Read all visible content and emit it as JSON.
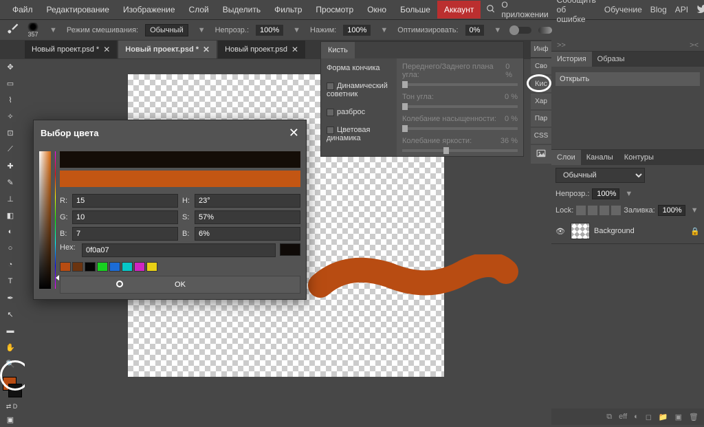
{
  "menubar": {
    "items": [
      "Файл",
      "Редактирование",
      "Изображение",
      "Слой",
      "Выделить",
      "Фильтр",
      "Просмотр",
      "Окно",
      "Больше"
    ],
    "account": "Аккаунт",
    "right": [
      "О приложении",
      "Сообщить об ошибке",
      "Обучение",
      "Blog",
      "API"
    ]
  },
  "optionsbar": {
    "brush_size": "357",
    "blend_mode_label": "Режим смешивания:",
    "blend_mode": "Обычный",
    "opacity_label": "Непрозр.:",
    "opacity": "100%",
    "flow_label": "Нажим:",
    "flow": "100%",
    "smooth_label": "Оптимизировать:",
    "smooth": "0%"
  },
  "tabs": [
    {
      "label": "Новый проект.psd *",
      "active": false
    },
    {
      "label": "Новый проект.psd *",
      "active": true
    },
    {
      "label": "Новый проект.psd",
      "active": false
    }
  ],
  "colorpicker": {
    "title": "Выбор цвета",
    "r_label": "R:",
    "r": "15",
    "g_label": "G:",
    "g": "10",
    "b_label": "B:",
    "b": "7",
    "h_label": "H:",
    "h": "23°",
    "s_label": "S:",
    "s": "57%",
    "v_label": "B:",
    "v": "6%",
    "hex_label": "Hex:",
    "hex": "0f0a07",
    "ok": "OK",
    "swatches": [
      "#b84c12",
      "#6b3410",
      "#050505",
      "#18d020",
      "#1c6cd6",
      "#07c7c7",
      "#d025c2",
      "#e8d015"
    ]
  },
  "brushpanel": {
    "tab": "Кисть",
    "tip_shape": "Форма кончика",
    "dynamic_label": "Динамический советник",
    "scatter_label": "разброс",
    "color_dyn_label": "Цветовая динамика",
    "fg_bg_label": "Переднего/Заднего плана угла:",
    "fg_bg_val": "0 %",
    "hue_label": "Тон угла:",
    "hue_val": "0 %",
    "sat_label": "Колебание насыщенности:",
    "sat_val": "0 %",
    "bri_label": "Колебание яркости:",
    "bri_val": "36 %"
  },
  "side_tabs": [
    "Инф",
    "Сво",
    "Кис",
    "Хар",
    "Пар",
    "CSS"
  ],
  "history_panel": {
    "tabs": [
      "История",
      "Образы"
    ],
    "action": "Открыть"
  },
  "layers_panel": {
    "tabs": [
      "Слои",
      "Каналы",
      "Контуры"
    ],
    "blend_mode": "Обычный",
    "opacity_label": "Непрозр.:",
    "opacity": "100%",
    "lock_label": "Lock:",
    "fill_label": "Заливка:",
    "fill": "100%",
    "layer_name": "Background"
  },
  "bottombar": {
    "eff": "eff"
  },
  "mini_header": {
    "left": ">>",
    "right": "><"
  }
}
